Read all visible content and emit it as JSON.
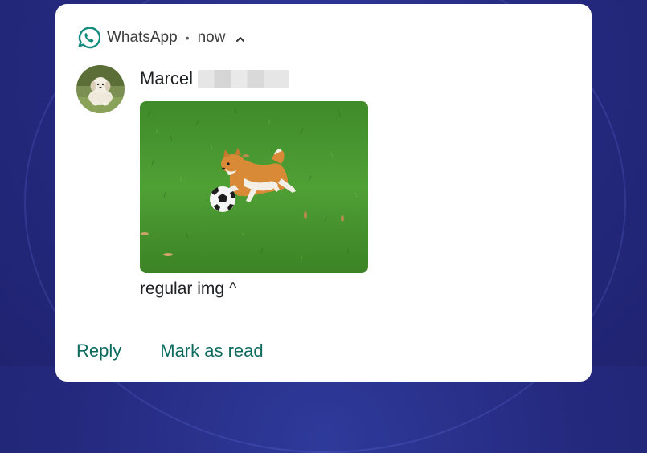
{
  "notification": {
    "app_name": "WhatsApp",
    "separator": "•",
    "time": "now",
    "sender": "Marcel",
    "message": "regular img ^",
    "image_alt": "shiba puppy playing with soccer ball on grass",
    "actions": [
      "Reply",
      "Mark as read"
    ]
  },
  "colors": {
    "accent": "#0b6b5e",
    "whatsapp_green": "#128c7e",
    "background": "#25297e"
  }
}
